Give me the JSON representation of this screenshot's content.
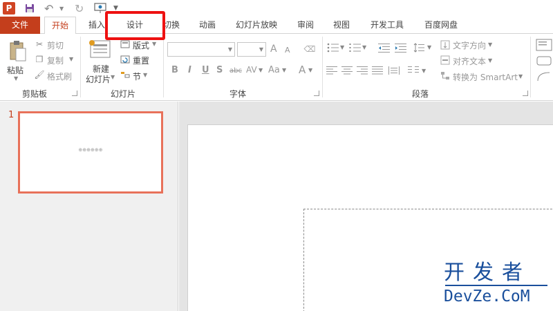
{
  "qat": {
    "logo": "P",
    "icons": [
      "powerpoint-logo-icon",
      "save-icon",
      "undo-icon",
      "redo-icon",
      "present-from-start-icon",
      "customize-toolbar-icon"
    ]
  },
  "tabs": {
    "file": "文件",
    "home": "开始",
    "insert": "插入",
    "design": "设计",
    "transitions": "切换",
    "animations": "动画",
    "slideshow": "幻灯片放映",
    "review": "审阅",
    "view": "视图",
    "developer": "开发工具",
    "baidu": "百度网盘"
  },
  "ribbon": {
    "clipboard": {
      "paste": "粘贴",
      "cut": "剪切",
      "copy": "复制",
      "format_painter": "格式刷",
      "label": "剪贴板"
    },
    "slides": {
      "new_slide_line1": "新建",
      "new_slide_line2": "幻灯片",
      "layout": "版式",
      "reset": "重置",
      "section": "节",
      "label": "幻灯片"
    },
    "font": {
      "bold": "B",
      "italic": "I",
      "underline": "U",
      "shadow": "S",
      "strike": "abc",
      "spacing": "AV",
      "case": "Aa",
      "color": "A",
      "grow": "A",
      "shrink": "A",
      "label": "字体"
    },
    "paragraph": {
      "text_direction": "文字方向",
      "align_text": "对齐文本",
      "convert_smartart": "转换为 SmartArt",
      "label": "段落"
    }
  },
  "thumbnails": {
    "slide_number": "1",
    "thumb_text": "⊕⊕⊕⊕⊕⊕"
  },
  "watermark": {
    "top": "开发者",
    "bottom": "DevZe.CoM"
  },
  "colors": {
    "accent": "#c43e1c",
    "highlight": "#ee1111",
    "watermark": "#1a4f9c"
  }
}
